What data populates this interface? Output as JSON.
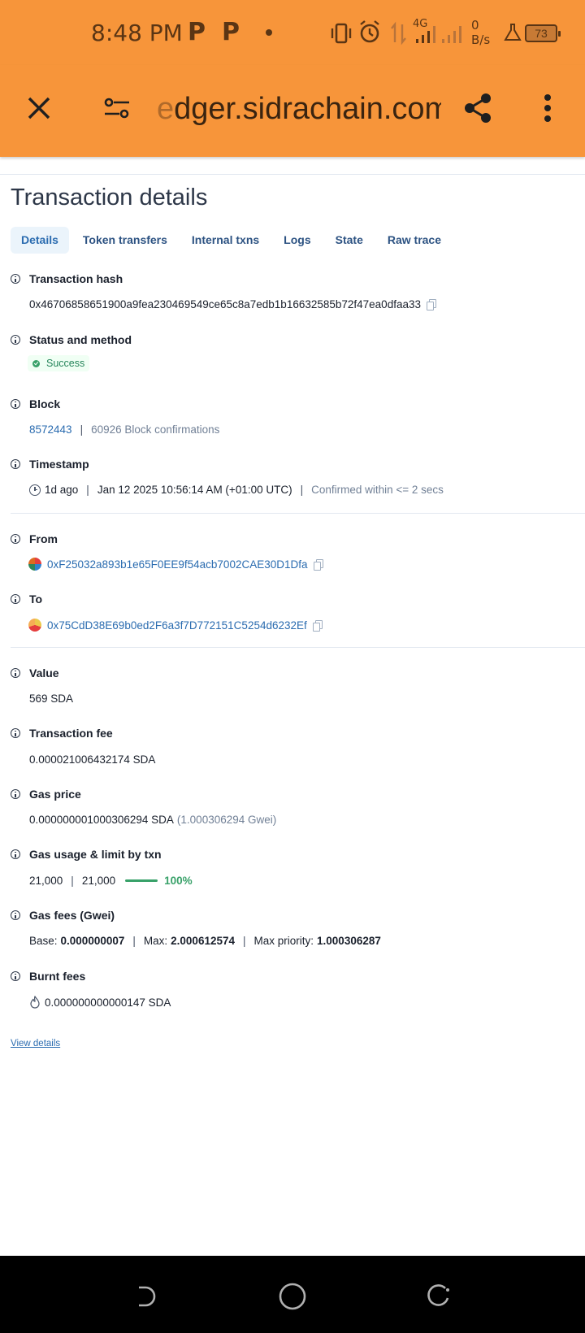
{
  "status_bar": {
    "time": "8:48 PM",
    "notif_icons": [
      "P",
      "P"
    ],
    "network_type": "4G",
    "data_speed_value": "0",
    "data_speed_unit": "B/s",
    "battery": "73"
  },
  "browser": {
    "url_prefix": "e",
    "url_rest": "dger.sidrachain.com",
    "close_icon": "close-icon",
    "settings_icon": "tune-icon",
    "share_icon": "share-icon",
    "menu_icon": "more-vertical-icon"
  },
  "page": {
    "title": "Transaction details",
    "tabs": [
      "Details",
      "Token transfers",
      "Internal txns",
      "Logs",
      "State",
      "Raw trace"
    ],
    "active_tab": "Details"
  },
  "fields": {
    "tx_hash": {
      "label": "Transaction hash",
      "value": "0x46706858651900a9fea230469549ce65c8a7edb1b16632585b72f47ea0dfaa33"
    },
    "status": {
      "label": "Status and method",
      "value": "Success"
    },
    "block": {
      "label": "Block",
      "number": "8572443",
      "confirmations": "60926 Block confirmations"
    },
    "timestamp": {
      "label": "Timestamp",
      "ago": "1d ago",
      "datetime": "Jan 12 2025 10:56:14 AM (+01:00 UTC)",
      "confirmed": "Confirmed within <= 2 secs"
    },
    "from": {
      "label": "From",
      "address": "0xF25032a893b1e65F0EE9f54acb7002CAE30D1Dfa"
    },
    "to": {
      "label": "To",
      "address": "0x75CdD38E69b0ed2F6a3f7D772151C5254d6232Ef"
    },
    "value": {
      "label": "Value",
      "value": "569 SDA"
    },
    "tx_fee": {
      "label": "Transaction fee",
      "value": "0.000021006432174 SDA"
    },
    "gas_price": {
      "label": "Gas price",
      "value": "0.000000001000306294 SDA",
      "gwei": "(1.000306294 Gwei)"
    },
    "gas_usage": {
      "label": "Gas usage & limit by txn",
      "used": "21,000",
      "limit": "21,000",
      "percent": "100%",
      "percent_value": 100
    },
    "gas_fees": {
      "label": "Gas fees (Gwei)",
      "base_label": "Base:",
      "base": "0.000000007",
      "max_label": "Max:",
      "max": "2.000612574",
      "priority_label": "Max priority:",
      "priority": "1.000306287"
    },
    "burnt_fees": {
      "label": "Burnt fees",
      "value": "0.000000000000147 SDA"
    }
  },
  "view_details": "View details",
  "colors": {
    "brand_bar": "#f7953a",
    "link": "#2b6cb0",
    "success": "#38a169"
  }
}
